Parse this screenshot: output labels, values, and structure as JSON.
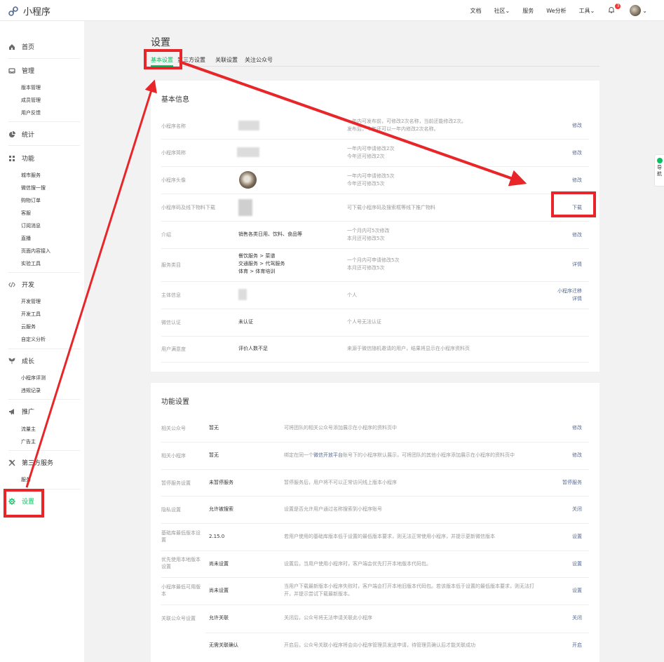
{
  "topbar": {
    "app_name": "小程序",
    "nav": [
      "文档",
      "社区",
      "服务",
      "We分析",
      "工具"
    ],
    "notification_count": "3"
  },
  "sidebar": {
    "sections": [
      {
        "label": "首页",
        "icon": "home-icon"
      },
      {
        "label": "管理",
        "icon": "inbox-icon",
        "items": [
          "版本管理",
          "成员管理",
          "用户反馈"
        ]
      },
      {
        "label": "统计",
        "icon": "pie-chart-icon"
      },
      {
        "label": "功能",
        "icon": "grid-icon",
        "items": [
          "城市服务",
          "微信搜一搜",
          "购物订单",
          "客服",
          "订阅消息",
          "直播",
          "页面内容接入",
          "实验工具"
        ]
      },
      {
        "label": "开发",
        "icon": "code-icon",
        "items": [
          "开发管理",
          "开发工具",
          "云服务",
          "自定义分析"
        ]
      },
      {
        "label": "成长",
        "icon": "leaf-icon",
        "items": [
          "小程序评测",
          "违规记录"
        ]
      },
      {
        "label": "推广",
        "icon": "megaphone-icon",
        "items": [
          "流量主",
          "广告主"
        ]
      },
      {
        "label": "第三方服务",
        "icon": "x-icon",
        "items": [
          "服务"
        ]
      },
      {
        "label": "设置",
        "icon": "gear-icon"
      }
    ]
  },
  "page": {
    "title": "设置",
    "tabs": [
      "基本设置",
      "第三方设置",
      "关联设置",
      "关注公众号"
    ]
  },
  "basic": {
    "title": "基本信息",
    "rows": [
      {
        "label": "小程序名称",
        "hint1": "一年内可发布前，可修改2次名称，当前还能修改2次。",
        "hint2": "发布后，今年还可以一年内修改2次名称。",
        "action": "修改"
      },
      {
        "label": "小程序简称",
        "hint1": "一年内可申请修改2次",
        "hint2": "今年还可修改2次",
        "action": "修改"
      },
      {
        "label": "小程序头像",
        "hint1": "一年内可申请修改5次",
        "hint2": "今年还可修改5次",
        "action": "修改"
      },
      {
        "label": "小程序码及线下物料下载",
        "hint1": "可下载小程序码及搜索框等线下推广物料",
        "action": "下载"
      },
      {
        "label": "介绍",
        "value": "销售各类日用、饮料、食品等",
        "hint1": "一个月内可5次修改",
        "hint2": "本月还可修改5次",
        "action": "修改"
      },
      {
        "label": "服务类目",
        "value_lines": [
          "餐饮服务 > 菜谱",
          "交通服务 > 代驾服务",
          "体育 > 体育培训"
        ],
        "hint1": "一个月内可申请修改5次",
        "hint2": "本月还可修改5次",
        "action": "详情"
      },
      {
        "label": "主体信息",
        "hint1": "个人",
        "action_lines": [
          "小程序迁移",
          "详情"
        ]
      },
      {
        "label": "微信认证",
        "value": "未认证",
        "hint1": "个人号无法认证"
      },
      {
        "label": "用户满意度",
        "value": "评价人数不足",
        "hint1": "来源于微信随机邀请的用户，结果将显示在小程序资料页"
      }
    ]
  },
  "func": {
    "title": "功能设置",
    "rows": [
      {
        "label": "相关公众号",
        "value": "暂无",
        "hint1": "可将团队的相关公众号添加展示在小程序的资料页中",
        "action": "修改"
      },
      {
        "label": "相关小程序",
        "value": "暂无",
        "hint_pre": "绑定在同一个",
        "hint_link": "微信开放平台",
        "hint_post": "账号下的小程序默认展示，可将团队的其他小程序添加展示在小程序的资料页中",
        "action": "修改"
      },
      {
        "label": "暂停服务设置",
        "value": "未暂停服务",
        "hint1": "暂停服务后，用户将不可以正常访问线上版本小程序",
        "action": "暂停服务"
      },
      {
        "label": "隐私设置",
        "value": "允许被搜索",
        "hint1": "设置是否允许用户通过名称搜索到小程序账号",
        "action": "关闭"
      },
      {
        "label": "基础库最低版本设置",
        "value": "2.15.0",
        "hint1": "若用户使用的基础库版本低于设置的最低版本要求，则无法正常使用小程序，并提示更新微信版本",
        "action": "设置"
      },
      {
        "label": "优先使用本地版本设置",
        "value": "尚未设置",
        "hint1": "设置后，当用户使用小程序时，客户端会优先打开本地版本代码包。",
        "action": "设置"
      },
      {
        "label": "小程序最低可用版本",
        "value": "尚未设置",
        "hint1": "当用户下载最新版本小程序失败时，客户端会打开本地旧版本代码包。若该版本低于设置的最低版本要求，则无法打",
        "hint2": "开，并提示尝试下载最新版本。",
        "action": "设置"
      },
      {
        "label": "关联公众号设置",
        "value": "允许关联",
        "hint1": "关闭后，公众号将无法申请关联此小程序",
        "action": "关闭"
      },
      {
        "label": "",
        "value": "无需关联确认",
        "hint1": "开启后，公众号关联小程序将会向小程序管理员发送申请，待管理员确认后才能关联成功",
        "action": "开启"
      }
    ]
  },
  "right_tab": "导航",
  "colors": {
    "accent": "#07c160",
    "link": "#576b95",
    "annotation": "#e8262a"
  }
}
